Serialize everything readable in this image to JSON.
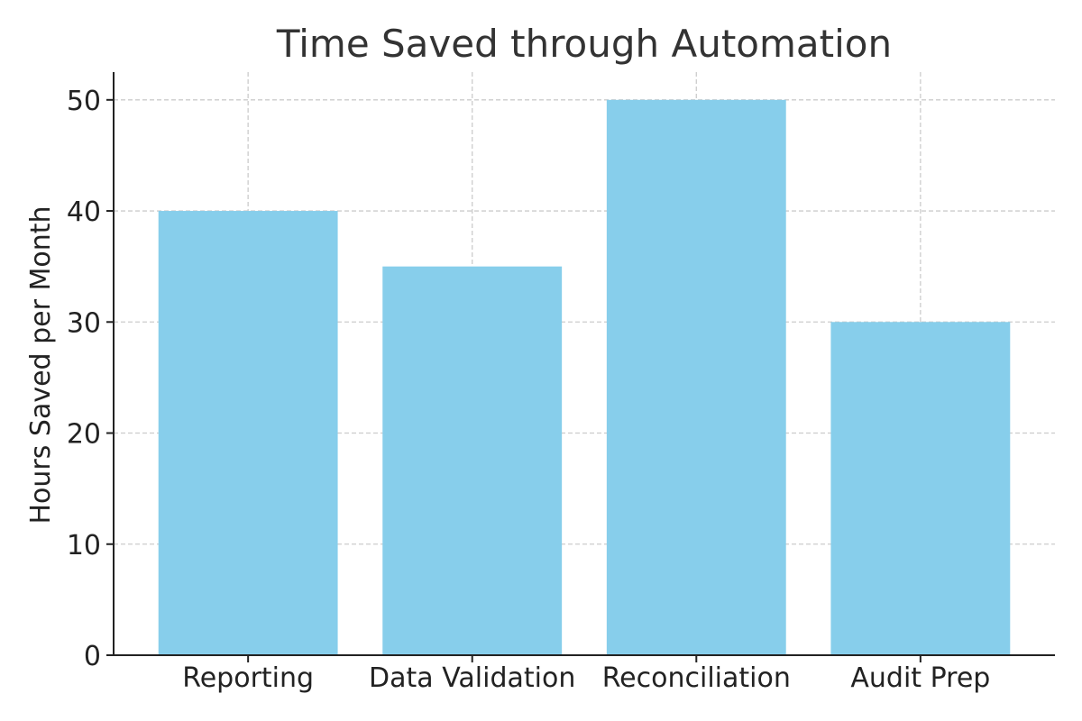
{
  "chart_data": {
    "type": "bar",
    "title": "Time Saved through Automation",
    "xlabel": "",
    "ylabel": "Hours Saved per Month",
    "categories": [
      "Reporting",
      "Data Validation",
      "Reconciliation",
      "Audit Prep"
    ],
    "values": [
      40,
      35,
      50,
      30
    ],
    "ylim": [
      0,
      52.5
    ],
    "yticks": [
      0,
      10,
      20,
      30,
      40,
      50
    ],
    "grid": true,
    "bar_color": "#87CEEB",
    "grid_color": "#cccccc",
    "axis_color": "#222222",
    "text_color": "#333333"
  }
}
